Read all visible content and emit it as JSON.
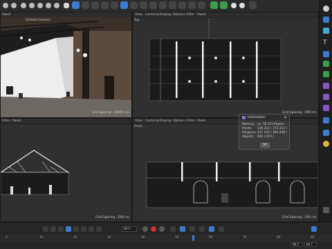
{
  "viewports": {
    "perspective": {
      "menus": [
        "View",
        "Cameras",
        "Display",
        "Options",
        "Filter",
        "Panel"
      ],
      "label": "Default Camera",
      "grid": "Grid Spacing : 10000 cm"
    },
    "top": {
      "menus": [
        "View",
        "Cameras",
        "Display",
        "Options",
        "Filter",
        "Panel"
      ],
      "label": "Top",
      "grid": "Grid Spacing : 500 cm"
    },
    "right": {
      "menus": [
        "Filter",
        "Panel"
      ],
      "grid": "Grid Spacing : 500 cm"
    },
    "front": {
      "menus": [
        "View",
        "Cameras",
        "Display",
        "Options",
        "Filter",
        "Panel"
      ],
      "label": "Front",
      "grid": "Grid Spacing : 500 cm"
    }
  },
  "dialog": {
    "title": "Information",
    "rows": [
      {
        "label": "Memory:",
        "value": "ca. 78 371 Kbytes"
      },
      {
        "label": "Points:",
        "value": "438 212 ( 372 312 )"
      },
      {
        "label": "Polygons:",
        "value": "437 522 ( 363 448 )"
      },
      {
        "label": "Objects:",
        "value": "665 ( 474 )"
      }
    ],
    "ok_label": "OK"
  },
  "timeline": {
    "frame_field": "90 F",
    "end_field_a": "90 F",
    "end_field_b": "90 F",
    "ruler": [
      "0",
      "10",
      "20",
      "30",
      "40",
      "50",
      "60",
      "70",
      "80",
      "90"
    ]
  },
  "icons": [
    "move-icon",
    "scale-icon",
    "rotate-icon",
    "undo-icon",
    "cube-icon",
    "pen-icon",
    "text-icon",
    "light-icon",
    "camera-icon",
    "render-icon"
  ]
}
